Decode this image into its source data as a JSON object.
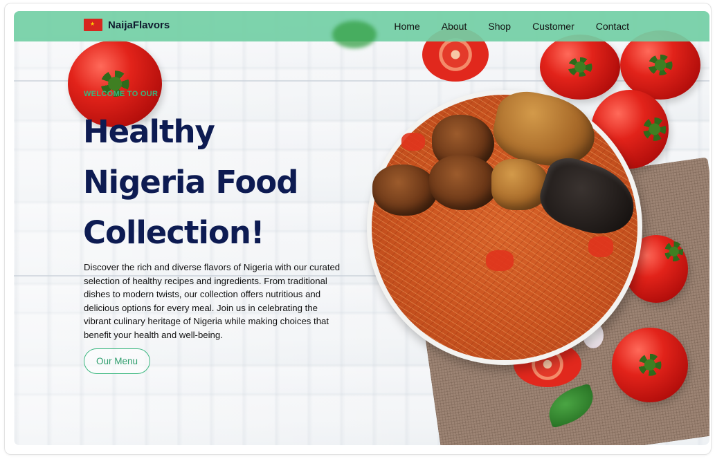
{
  "brand": {
    "name": "NaijaFlavors",
    "flag_icon": "nigeria-flag-icon"
  },
  "nav": {
    "items": [
      {
        "label": "Home"
      },
      {
        "label": "About"
      },
      {
        "label": "Shop"
      },
      {
        "label": "Customer"
      },
      {
        "label": "Contact"
      }
    ]
  },
  "hero": {
    "eyebrow": "WELCOME TO OUR",
    "headline_lines": [
      "Healthy",
      "Nigeria Food",
      "Collection!"
    ],
    "description": "Discover the rich and diverse flavors of Nigeria with our curated selection of healthy recipes and ingredients. From traditional dishes to modern twists, our collection offers nutritious and delicious options for every meal. Join us in celebrating the vibrant culinary heritage of Nigeria while making choices that benefit your health and well-being.",
    "cta_label": "Our Menu"
  },
  "colors": {
    "navbar_bg": "#73cfa5",
    "headline": "#0d1b52",
    "accent_green": "#3ab57f"
  }
}
